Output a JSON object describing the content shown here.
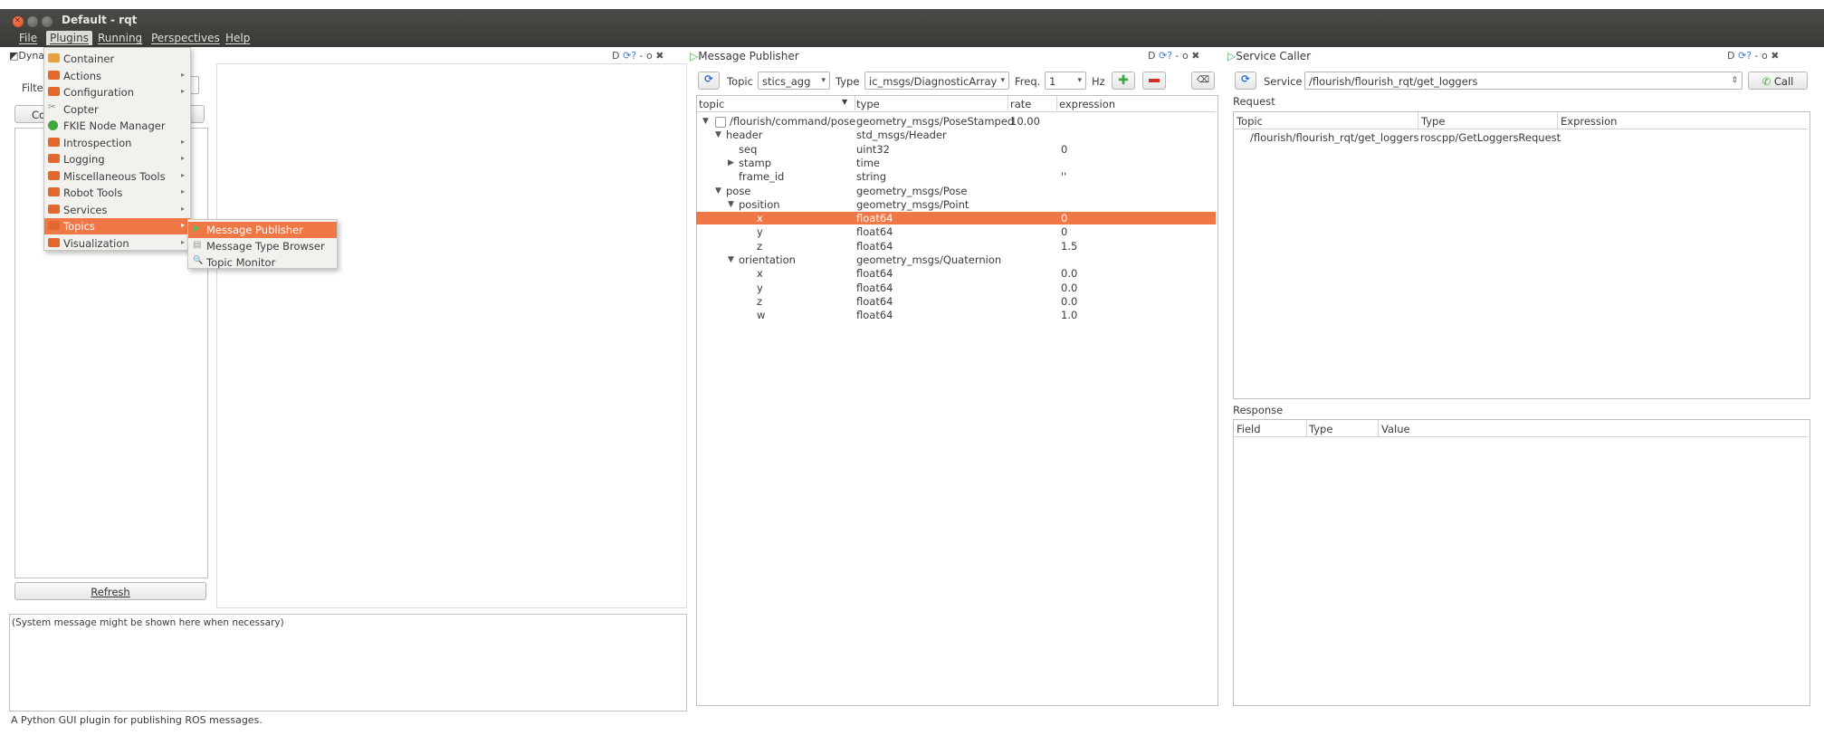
{
  "window": {
    "title": "Default - rqt"
  },
  "menubar": [
    "File",
    "Plugins",
    "Running",
    "Perspectives",
    "Help"
  ],
  "plugins_menu": {
    "items": [
      {
        "label": "Container",
        "icon": "container-icon",
        "submenu": false
      },
      {
        "label": "Actions",
        "icon": "folder-icon",
        "submenu": true
      },
      {
        "label": "Configuration",
        "icon": "folder-icon",
        "submenu": true
      },
      {
        "label": "Copter",
        "icon": "copter-icon",
        "submenu": false
      },
      {
        "label": "FKIE Node Manager",
        "icon": "green-circle-icon",
        "submenu": false
      },
      {
        "label": "Introspection",
        "icon": "folder-icon",
        "submenu": true
      },
      {
        "label": "Logging",
        "icon": "folder-icon",
        "submenu": true
      },
      {
        "label": "Miscellaneous Tools",
        "icon": "folder-icon",
        "submenu": true
      },
      {
        "label": "Robot Tools",
        "icon": "folder-icon",
        "submenu": true
      },
      {
        "label": "Services",
        "icon": "folder-icon",
        "submenu": true
      },
      {
        "label": "Topics",
        "icon": "folder-icon",
        "submenu": true,
        "active": true
      },
      {
        "label": "Visualization",
        "icon": "folder-icon",
        "submenu": true
      }
    ],
    "topics_submenu": [
      {
        "label": "Message Publisher",
        "icon": "play-icon",
        "active": true
      },
      {
        "label": "Message Type Browser",
        "icon": "browser-icon"
      },
      {
        "label": "Topic Monitor",
        "icon": "magnifier-icon"
      }
    ]
  },
  "left_dock": {
    "title_fragment": "Dyna",
    "filter_label": "Filte",
    "button_fragment": "Co",
    "refresh_label": "Refresh",
    "dock_controls": "D",
    "system_message": "(System message might be shown here when necessary)"
  },
  "publisher": {
    "title": "Message Publisher",
    "dock_controls": "D",
    "topic_label": "Topic",
    "topic_value": "stics_agg",
    "type_label": "Type",
    "type_value": "ic_msgs/DiagnosticArray",
    "freq_label": "Freq.",
    "freq_value": "1",
    "hz_label": "Hz",
    "columns": [
      "topic",
      "type",
      "rate",
      "expression"
    ],
    "rows": [
      {
        "indent": 0,
        "arrow": "▼",
        "checkbox": true,
        "topic": "/flourish/command/pose",
        "type": "geometry_msgs/PoseStamped",
        "rate": "10.00",
        "expression": ""
      },
      {
        "indent": 1,
        "arrow": "▼",
        "topic": "header",
        "type": "std_msgs/Header",
        "rate": "",
        "expression": ""
      },
      {
        "indent": 2,
        "arrow": "",
        "topic": "seq",
        "type": "uint32",
        "rate": "",
        "expression": "0"
      },
      {
        "indent": 2,
        "arrow": "▶",
        "topic": "stamp",
        "type": "time",
        "rate": "",
        "expression": ""
      },
      {
        "indent": 2,
        "arrow": "",
        "topic": "frame_id",
        "type": "string",
        "rate": "",
        "expression": "''"
      },
      {
        "indent": 1,
        "arrow": "▼",
        "topic": "pose",
        "type": "geometry_msgs/Pose",
        "rate": "",
        "expression": ""
      },
      {
        "indent": 2,
        "arrow": "▼",
        "topic": "position",
        "type": "geometry_msgs/Point",
        "rate": "",
        "expression": ""
      },
      {
        "indent": 3,
        "arrow": "",
        "topic": "x",
        "type": "float64",
        "rate": "",
        "expression": "0",
        "selected": true
      },
      {
        "indent": 3,
        "arrow": "",
        "topic": "y",
        "type": "float64",
        "rate": "",
        "expression": "0"
      },
      {
        "indent": 3,
        "arrow": "",
        "topic": "z",
        "type": "float64",
        "rate": "",
        "expression": "1.5"
      },
      {
        "indent": 2,
        "arrow": "▼",
        "topic": "orientation",
        "type": "geometry_msgs/Quaternion",
        "rate": "",
        "expression": ""
      },
      {
        "indent": 3,
        "arrow": "",
        "topic": "x",
        "type": "float64",
        "rate": "",
        "expression": "0.0"
      },
      {
        "indent": 3,
        "arrow": "",
        "topic": "y",
        "type": "float64",
        "rate": "",
        "expression": "0.0"
      },
      {
        "indent": 3,
        "arrow": "",
        "topic": "z",
        "type": "float64",
        "rate": "",
        "expression": "0.0"
      },
      {
        "indent": 3,
        "arrow": "",
        "topic": "w",
        "type": "float64",
        "rate": "",
        "expression": "1.0"
      }
    ]
  },
  "service_caller": {
    "title": "Service Caller",
    "dock_controls": "D",
    "service_label": "Service",
    "service_value": "/flourish/flourish_rqt/get_loggers",
    "call_label": "Call",
    "request_label": "Request",
    "request_columns": [
      "Topic",
      "Type",
      "Expression"
    ],
    "request_rows": [
      {
        "topic": "/flourish/flourish_rqt/get_loggers",
        "type": "roscpp/GetLoggersRequest",
        "expression": ""
      }
    ],
    "response_label": "Response",
    "response_columns": [
      "Field",
      "Type",
      "Value"
    ]
  },
  "statusbar": {
    "text": "A Python GUI plugin for publishing ROS messages."
  },
  "colors": {
    "accent": "#f07746",
    "titlebar": "#3c3b37"
  }
}
